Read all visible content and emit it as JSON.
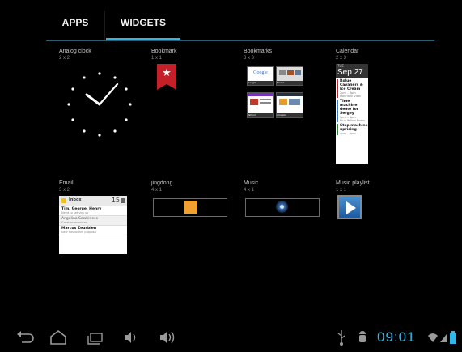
{
  "tabs": [
    {
      "label": "APPS"
    },
    {
      "label": "WIDGETS"
    }
  ],
  "widgets": [
    {
      "name": "Analog clock",
      "size": "2 x 2"
    },
    {
      "name": "Bookmark",
      "size": "1 x 1"
    },
    {
      "name": "Bookmarks",
      "size": "3 x 3"
    },
    {
      "name": "Calendar",
      "size": "2 x 3"
    },
    {
      "name": "Email",
      "size": "3 x 2"
    },
    {
      "name": "jingdong",
      "size": "4 x 1"
    },
    {
      "name": "Music",
      "size": "4 x 1"
    },
    {
      "name": "Music playlist",
      "size": "1 x 1"
    }
  ],
  "bookmarks_thumbs": [
    "Google",
    "Picasa",
    "Yahoo!",
    "Amazon"
  ],
  "calendar": {
    "dow": "TUE",
    "date": "Sep 27",
    "events": [
      {
        "title": "Rolue Cavaliers &",
        "sub1": "Ice Cream",
        "sub2": "2pm – 3pm",
        "sub3": "Mountain View",
        "color": "#c51f2a"
      },
      {
        "title": "Time machine",
        "sub1": "demo for Sergey",
        "sub2": "3pm – 4pm",
        "sub3": "Blue Yellow Room",
        "color": "#2f7bd1"
      },
      {
        "title": "Stop machine",
        "sub1": "uprising",
        "sub2": "4pm – 5pm",
        "sub3": "",
        "color": "#2a8a3a"
      }
    ]
  },
  "email": {
    "header": "Inbox",
    "count": "15",
    "items": [
      {
        "from": "Tim, George, Henry",
        "snippet": "Need to set you up"
      },
      {
        "from": "Angelina Sawhiness",
        "snippet": "Great as expected"
      },
      {
        "from": "Marcus Zeusbien",
        "snippet": "New dashboard proposal"
      }
    ]
  },
  "status": {
    "time": "09:01"
  },
  "icons": [
    "back-icon",
    "home-icon",
    "recent-apps-icon",
    "volume-down-icon",
    "volume-up-icon",
    "usb-icon",
    "android-debug-icon",
    "wifi-icon",
    "signal-icon",
    "battery-icon"
  ],
  "colors": {
    "accent": "#33b5e5",
    "bookmark_red": "#c51f2a"
  }
}
